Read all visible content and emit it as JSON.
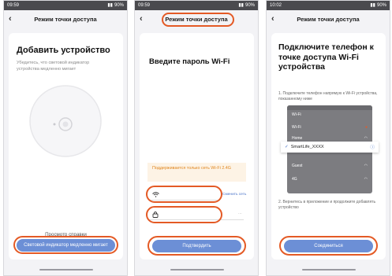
{
  "screens": [
    {
      "time": "09:59",
      "status_right": "90%",
      "title": "Режим точки доступа",
      "heading": "Добавить устройство",
      "subtitle": "Убедитесь, что световой индикатор устройства медленно мигает",
      "help_link": "Просмотр справки",
      "button": "Световой индикатор медленно мигает"
    },
    {
      "time": "09:59",
      "status_right": "90%",
      "title": "Режим точки доступа",
      "heading": "Введите пароль Wi-Fi",
      "warning": "Поддерживается только сеть Wi-Fi 2.4G",
      "change_network": "Сменить сеть",
      "button": "Подтвердить"
    },
    {
      "time": "10:02",
      "status_right": "90%",
      "title": "Режим точки доступа",
      "heading": "Подключите телефон к точке доступа Wi-Fi устройства",
      "step1": "1. Подключите телефон напрямую к Wi-Fi устройства, показанному ниже",
      "wifi_label": "Wi-Fi",
      "wifi_list": [
        "Wi-Fi",
        "Home",
        "Guest",
        "4G"
      ],
      "selected_network": "SmartLife_XXXX",
      "step2": "2. Вернитесь в приложение и продолжите добавлять устройство",
      "button": "Соединиться"
    }
  ],
  "colors": {
    "accent": "#6c8fd6",
    "highlight": "#e45a25",
    "status_bar": "#4a4a4e",
    "warning_bg": "#fdf3e5",
    "warning_text": "#e0861f"
  }
}
